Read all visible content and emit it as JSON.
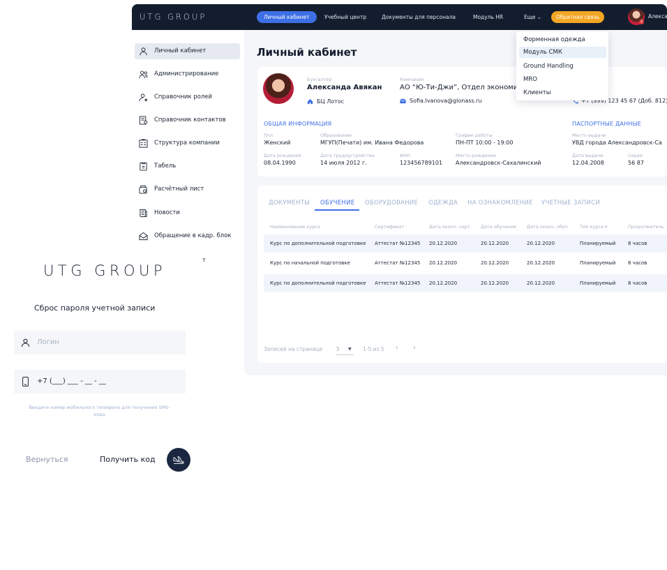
{
  "topbar": {
    "brand": "UTG GROUP",
    "nav": [
      "Личный кабинет",
      "Учебный центр",
      "Документы для персонала",
      "Модуль HR",
      "Еще ⌄"
    ],
    "feedback": "Обратная связь",
    "user_name": "Алекса",
    "badge": "2"
  },
  "dropdown": {
    "items": [
      "Форменная одежда",
      "Модуль СМК",
      "Ground Handling",
      "MRO",
      "Клиенты"
    ],
    "highlighted_index": 1
  },
  "sidebar": {
    "items": [
      {
        "label": "Личный кабинет",
        "icon": "user-icon"
      },
      {
        "label": "Администрирование",
        "icon": "users-admin-icon"
      },
      {
        "label": "Справочник ролей",
        "icon": "user-roles-icon"
      },
      {
        "label": "Справочник контактов",
        "icon": "contacts-icon"
      },
      {
        "label": "Структура компании",
        "icon": "company-structure-icon"
      },
      {
        "label": "Табель",
        "icon": "timesheet-icon"
      },
      {
        "label": "Расчётный лист",
        "icon": "payslip-icon"
      },
      {
        "label": "Новости",
        "icon": "news-icon"
      },
      {
        "label": "Обращение в кадр. блок",
        "icon": "hr-request-icon"
      }
    ],
    "stray_char": "т"
  },
  "page": {
    "title": "Личный кабинет"
  },
  "profile": {
    "position_label": "Бухгалтер",
    "name": "Александа Авякан",
    "office": "БЦ Лотос",
    "company_label": "Компания",
    "company": "АО “Ю-Ти-Джи”, Отдел экономи",
    "email": "Sofia.Ivanova@glonass.ru",
    "phone": "+7 (999) 123 45 67 (Доб. 812)"
  },
  "general": {
    "title": "ОБЩАЯ ИНФОРМАЦИЯ",
    "fields": [
      {
        "label": "Пол",
        "value": "Женский"
      },
      {
        "label": "Образование",
        "value": "МГУП(Печати) им. Ивана Федорова"
      },
      {
        "label": "График работы",
        "value": "ПН-ПТ 10:00 - 19:00"
      },
      {
        "label": "Дата рождения",
        "value": "08.04.1990"
      },
      {
        "label": "Дата трудоустройства",
        "value": "14 июля 2012 г."
      },
      {
        "label": "ИНН",
        "value": "123456789101"
      },
      {
        "label": "Место рождения",
        "value": "Александровск-Сахалинский"
      }
    ]
  },
  "passport": {
    "title": "ПАСПОРТНЫЕ ДАННЫЕ",
    "fields": [
      {
        "label": "Место выдачи",
        "value": "УВД города  Александровск-Са"
      },
      {
        "label": "Дата выдачи",
        "value": "12.04.2008"
      },
      {
        "label": "Серия",
        "value": "56 87"
      }
    ]
  },
  "tabs": [
    "ДОКУМЕНТЫ",
    "ОБУЧЕНИЕ",
    "ОБОРУДОВАНИЕ",
    "ОДЕЖДА",
    "НА ОЗНАКОМЛЕНИЕ",
    "УЧЕТНЫЕ ЗАПИСИ"
  ],
  "active_tab": 1,
  "table": {
    "headers": [
      "Наименование курса",
      "Сертификат",
      "Дата оконч. серт.",
      "Дата обучения",
      "Дата оконч. обуч.",
      "Тип курса ▾",
      "Продолжитель"
    ],
    "rows": [
      [
        "Курс по дополнительной подготовке",
        "Аттестат №12345",
        "20.12.2020",
        "20.12.2020",
        "20.12.2020",
        "Планируемый",
        "8 часов"
      ],
      [
        "Курс по начальной подготовке",
        "Аттестат №12345",
        "20.12.2020",
        "20.12.2020",
        "20.12.2020",
        "Планируемый",
        "8 часов"
      ],
      [
        "Курс по дополнительной подготовке",
        "Аттестат №12345",
        "20.12.2020",
        "20.12.2020",
        "20.12.2020",
        "Планируемый",
        "8 часов"
      ]
    ]
  },
  "pagination": {
    "label": "Записей на странице",
    "per_page": "5",
    "range": "1-5 из 5",
    "prev": "‹",
    "next": "›"
  },
  "login": {
    "brand": "UTG GROUP",
    "title": "Сброс пароля учетной записи",
    "login_placeholder": "Логин",
    "phone_value": "+7  (___) ___ - __ - __",
    "hint": "Введите номер мобильного телефона для получения SMS-кода",
    "back": "Вернуться",
    "get_code": "Получить код"
  },
  "colors": {
    "topbar": "#141d2e",
    "accent": "#3d6fe6",
    "feedback": "#f5a623",
    "content_bg": "#f4f6f9"
  }
}
